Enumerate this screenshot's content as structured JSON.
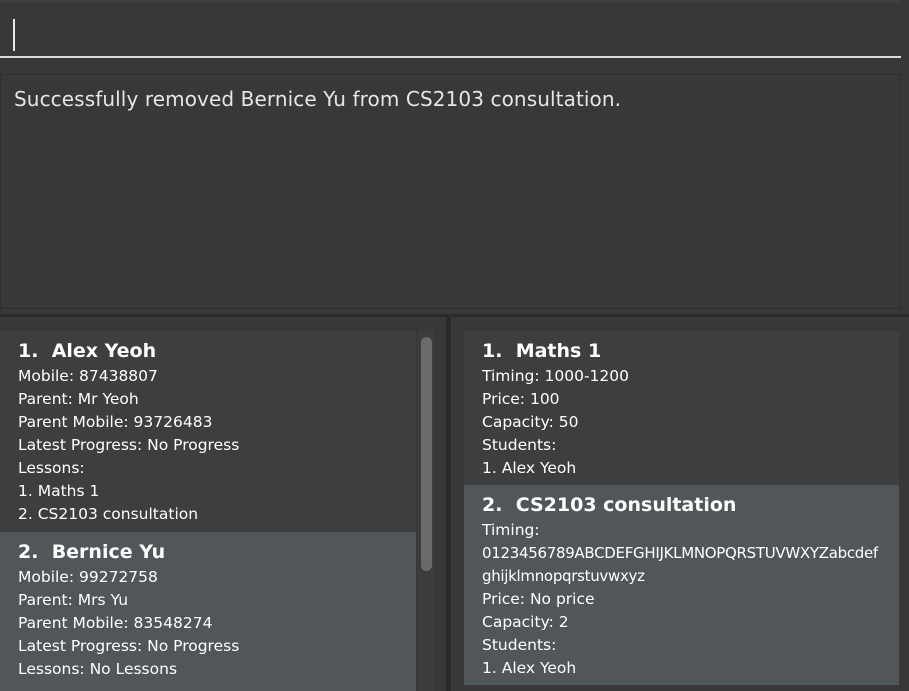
{
  "command": {
    "value": ""
  },
  "result": {
    "message": "Successfully removed Bernice Yu from CS2103 consultation."
  },
  "students": [
    {
      "index": "1.",
      "name": "Alex Yeoh",
      "mobile": "Mobile: 87438807",
      "parent": "Parent: Mr Yeoh",
      "parent_mobile": "Parent Mobile: 93726483",
      "progress": "Latest Progress: No Progress",
      "lessons_label": "Lessons:",
      "lessons": [
        "1.  Maths 1",
        "2.  CS2103 consultation"
      ]
    },
    {
      "index": "2.",
      "name": "Bernice Yu",
      "mobile": "Mobile: 99272758",
      "parent": "Parent: Mrs Yu",
      "parent_mobile": "Parent Mobile: 83548274",
      "progress": "Latest Progress: No Progress",
      "lessons_label": "Lessons: No Lessons"
    }
  ],
  "lessons": [
    {
      "index": "1.",
      "name": "Maths 1",
      "timing": "Timing: 1000-1200",
      "price": "Price: 100",
      "capacity": "Capacity: 50",
      "students_label": "Students:",
      "students": [
        "1.  Alex Yeoh"
      ]
    },
    {
      "index": "2.",
      "name": "CS2103 consultation",
      "timing_label": "Timing:",
      "timing_line1": "0123456789ABCDEFGHIJKLMNOPQRSTUVWXYZabcdef",
      "timing_line2": "ghijklmnopqrstuvwxyz",
      "price": "Price: No price",
      "capacity": "Capacity: 2",
      "students_label": "Students:",
      "students": [
        "1.  Alex Yeoh"
      ]
    }
  ]
}
